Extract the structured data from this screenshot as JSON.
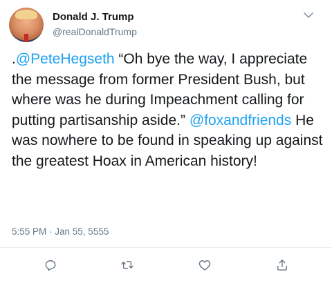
{
  "author": {
    "name": "Donald J. Trump",
    "handle": "@realDonaldTrump"
  },
  "tweet": {
    "prefix": ".",
    "mention1": "@PeteHegseth",
    "text1": " “Oh bye the way, I appreciate the message from former President Bush, but where was he during Impeachment calling for putting partisanship aside.” ",
    "mention2": "@foxandfriends",
    "text2": " He was nowhere to be found in speaking up against the greatest Hoax in American history!",
    "timestamp": "5:55 PM · Jan 55, 5555"
  },
  "actions": {
    "reply_icon": "reply-icon",
    "retweet_icon": "retweet-icon",
    "like_icon": "heart-icon",
    "share_icon": "share-icon"
  },
  "colors": {
    "link": "#1da1f2",
    "secondary_text": "#657786",
    "icon": "#657786"
  }
}
